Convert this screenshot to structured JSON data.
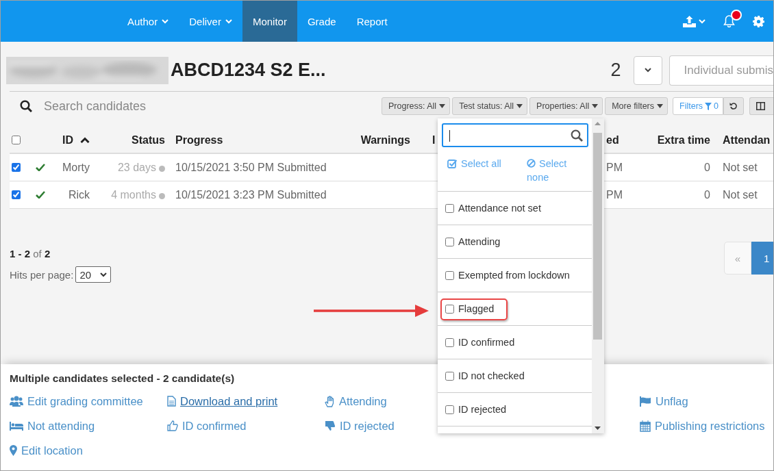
{
  "nav": {
    "items": [
      {
        "label": "Author",
        "dropdown": true,
        "selected": false
      },
      {
        "label": "Deliver",
        "dropdown": true,
        "selected": false
      },
      {
        "label": "Monitor",
        "dropdown": false,
        "selected": true
      },
      {
        "label": "Grade",
        "dropdown": false,
        "selected": false
      },
      {
        "label": "Report",
        "dropdown": false,
        "selected": false
      }
    ],
    "has_notification": true
  },
  "header": {
    "title": "ABCD1234 S2 E...",
    "count": "2",
    "submission_button": "Individual submis"
  },
  "search": {
    "placeholder": "Search candidates"
  },
  "filters": [
    {
      "label": "Progress: All"
    },
    {
      "label": "Test status: All"
    },
    {
      "label": "Properties: All"
    },
    {
      "label": "More filters"
    }
  ],
  "filter_summary": {
    "label": "Filters",
    "count": "0"
  },
  "table": {
    "select_all_checked": false,
    "columns": [
      {
        "label": "ID",
        "sorted": true
      },
      {
        "label": "Status",
        "sorted": false
      },
      {
        "label": "Progress",
        "sorted": false
      },
      {
        "label": "Warnings",
        "sorted": false
      },
      {
        "label": "I",
        "sorted": false
      },
      {
        "label": "ed",
        "sorted": false
      },
      {
        "label": "Extra time",
        "sorted": false
      },
      {
        "label": "Attendan",
        "sorted": false
      }
    ],
    "rows": [
      {
        "checked": true,
        "done": true,
        "cells": [
          "Morty",
          "23 days",
          "10/15/2021 3:50 PM Submitted",
          "",
          "",
          "PM",
          "0",
          "Not set"
        ]
      },
      {
        "checked": true,
        "done": true,
        "cells": [
          "Rick",
          "4 months",
          "10/15/2021 3:23 PM Submitted",
          "",
          "",
          "PM",
          "0",
          "Not set"
        ]
      }
    ]
  },
  "pagination": {
    "range": "1 - 2",
    "of": "of",
    "total": "2",
    "hits_label": "Hits per page:",
    "hits_value": "20",
    "pages": [
      {
        "label": "«",
        "selected": false
      },
      {
        "label": "1",
        "selected": true
      }
    ]
  },
  "bulk": {
    "title": "Multiple candidates selected - 2 candidate(s)",
    "actions": [
      {
        "label": "Edit grading committee",
        "kind": "users",
        "underlined": false
      },
      {
        "label": "Download and print",
        "kind": "document",
        "underlined": true
      },
      {
        "label": "Attending",
        "kind": "hand",
        "underlined": false
      },
      {
        "label": "Unflag",
        "kind": "flag",
        "underlined": false
      },
      {
        "label": "Not attending",
        "kind": "bed",
        "underlined": false
      },
      {
        "label": "ID confirmed",
        "kind": "thumbs-up",
        "underlined": false
      },
      {
        "label": "ID rejected",
        "kind": "thumbs-down",
        "underlined": false
      },
      {
        "label": "Publishing restrictions",
        "kind": "calendar",
        "underlined": false
      },
      {
        "label": "Edit location",
        "kind": "pin",
        "underlined": false
      }
    ]
  },
  "dropdown": {
    "select_all": "Select all",
    "select_none": "Select none",
    "options": [
      {
        "label": "Attendance not set",
        "checked": false,
        "highlighted": false
      },
      {
        "label": "Attending",
        "checked": false,
        "highlighted": false
      },
      {
        "label": "Exempted from lockdown",
        "checked": false,
        "highlighted": false
      },
      {
        "label": "Flagged",
        "checked": false,
        "highlighted": true
      },
      {
        "label": "ID confirmed",
        "checked": false,
        "highlighted": false
      },
      {
        "label": "ID not checked",
        "checked": false,
        "highlighted": false
      },
      {
        "label": "ID rejected",
        "checked": false,
        "highlighted": false
      }
    ]
  }
}
